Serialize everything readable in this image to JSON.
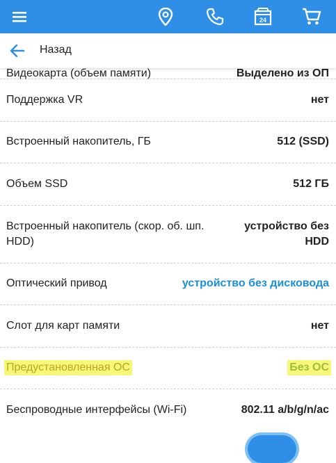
{
  "header": {
    "icons": [
      "menu-icon",
      "location-icon",
      "phone-icon",
      "store-icon",
      "cart-icon"
    ],
    "color": "#2f8fe6"
  },
  "back": {
    "label": "Назад"
  },
  "specs": [
    {
      "name": "Видеокарта (объем памяти)",
      "value": "Выделено из ОП"
    },
    {
      "name": "Поддержка VR",
      "value": "нет"
    },
    {
      "name": "Встроенный накопитель, ГБ",
      "value": "512 (SSD)"
    },
    {
      "name": "Объем SSD",
      "value": "512 ГБ"
    },
    {
      "name": "Встроенный накопитель (скор. об. шп. HDD)",
      "value": "устройство без HDD"
    },
    {
      "name": "Оптический привод",
      "value": "устройство без дисковода",
      "link": true
    },
    {
      "name": "Слот для карт памяти",
      "value": "нет"
    },
    {
      "name": "Предустановленная ОС",
      "value": "Без ОС",
      "highlighted": true
    },
    {
      "name": "Беспроводные интерфейсы (Wi-Fi)",
      "value": "802.11 a/b/g/n/ac"
    }
  ]
}
